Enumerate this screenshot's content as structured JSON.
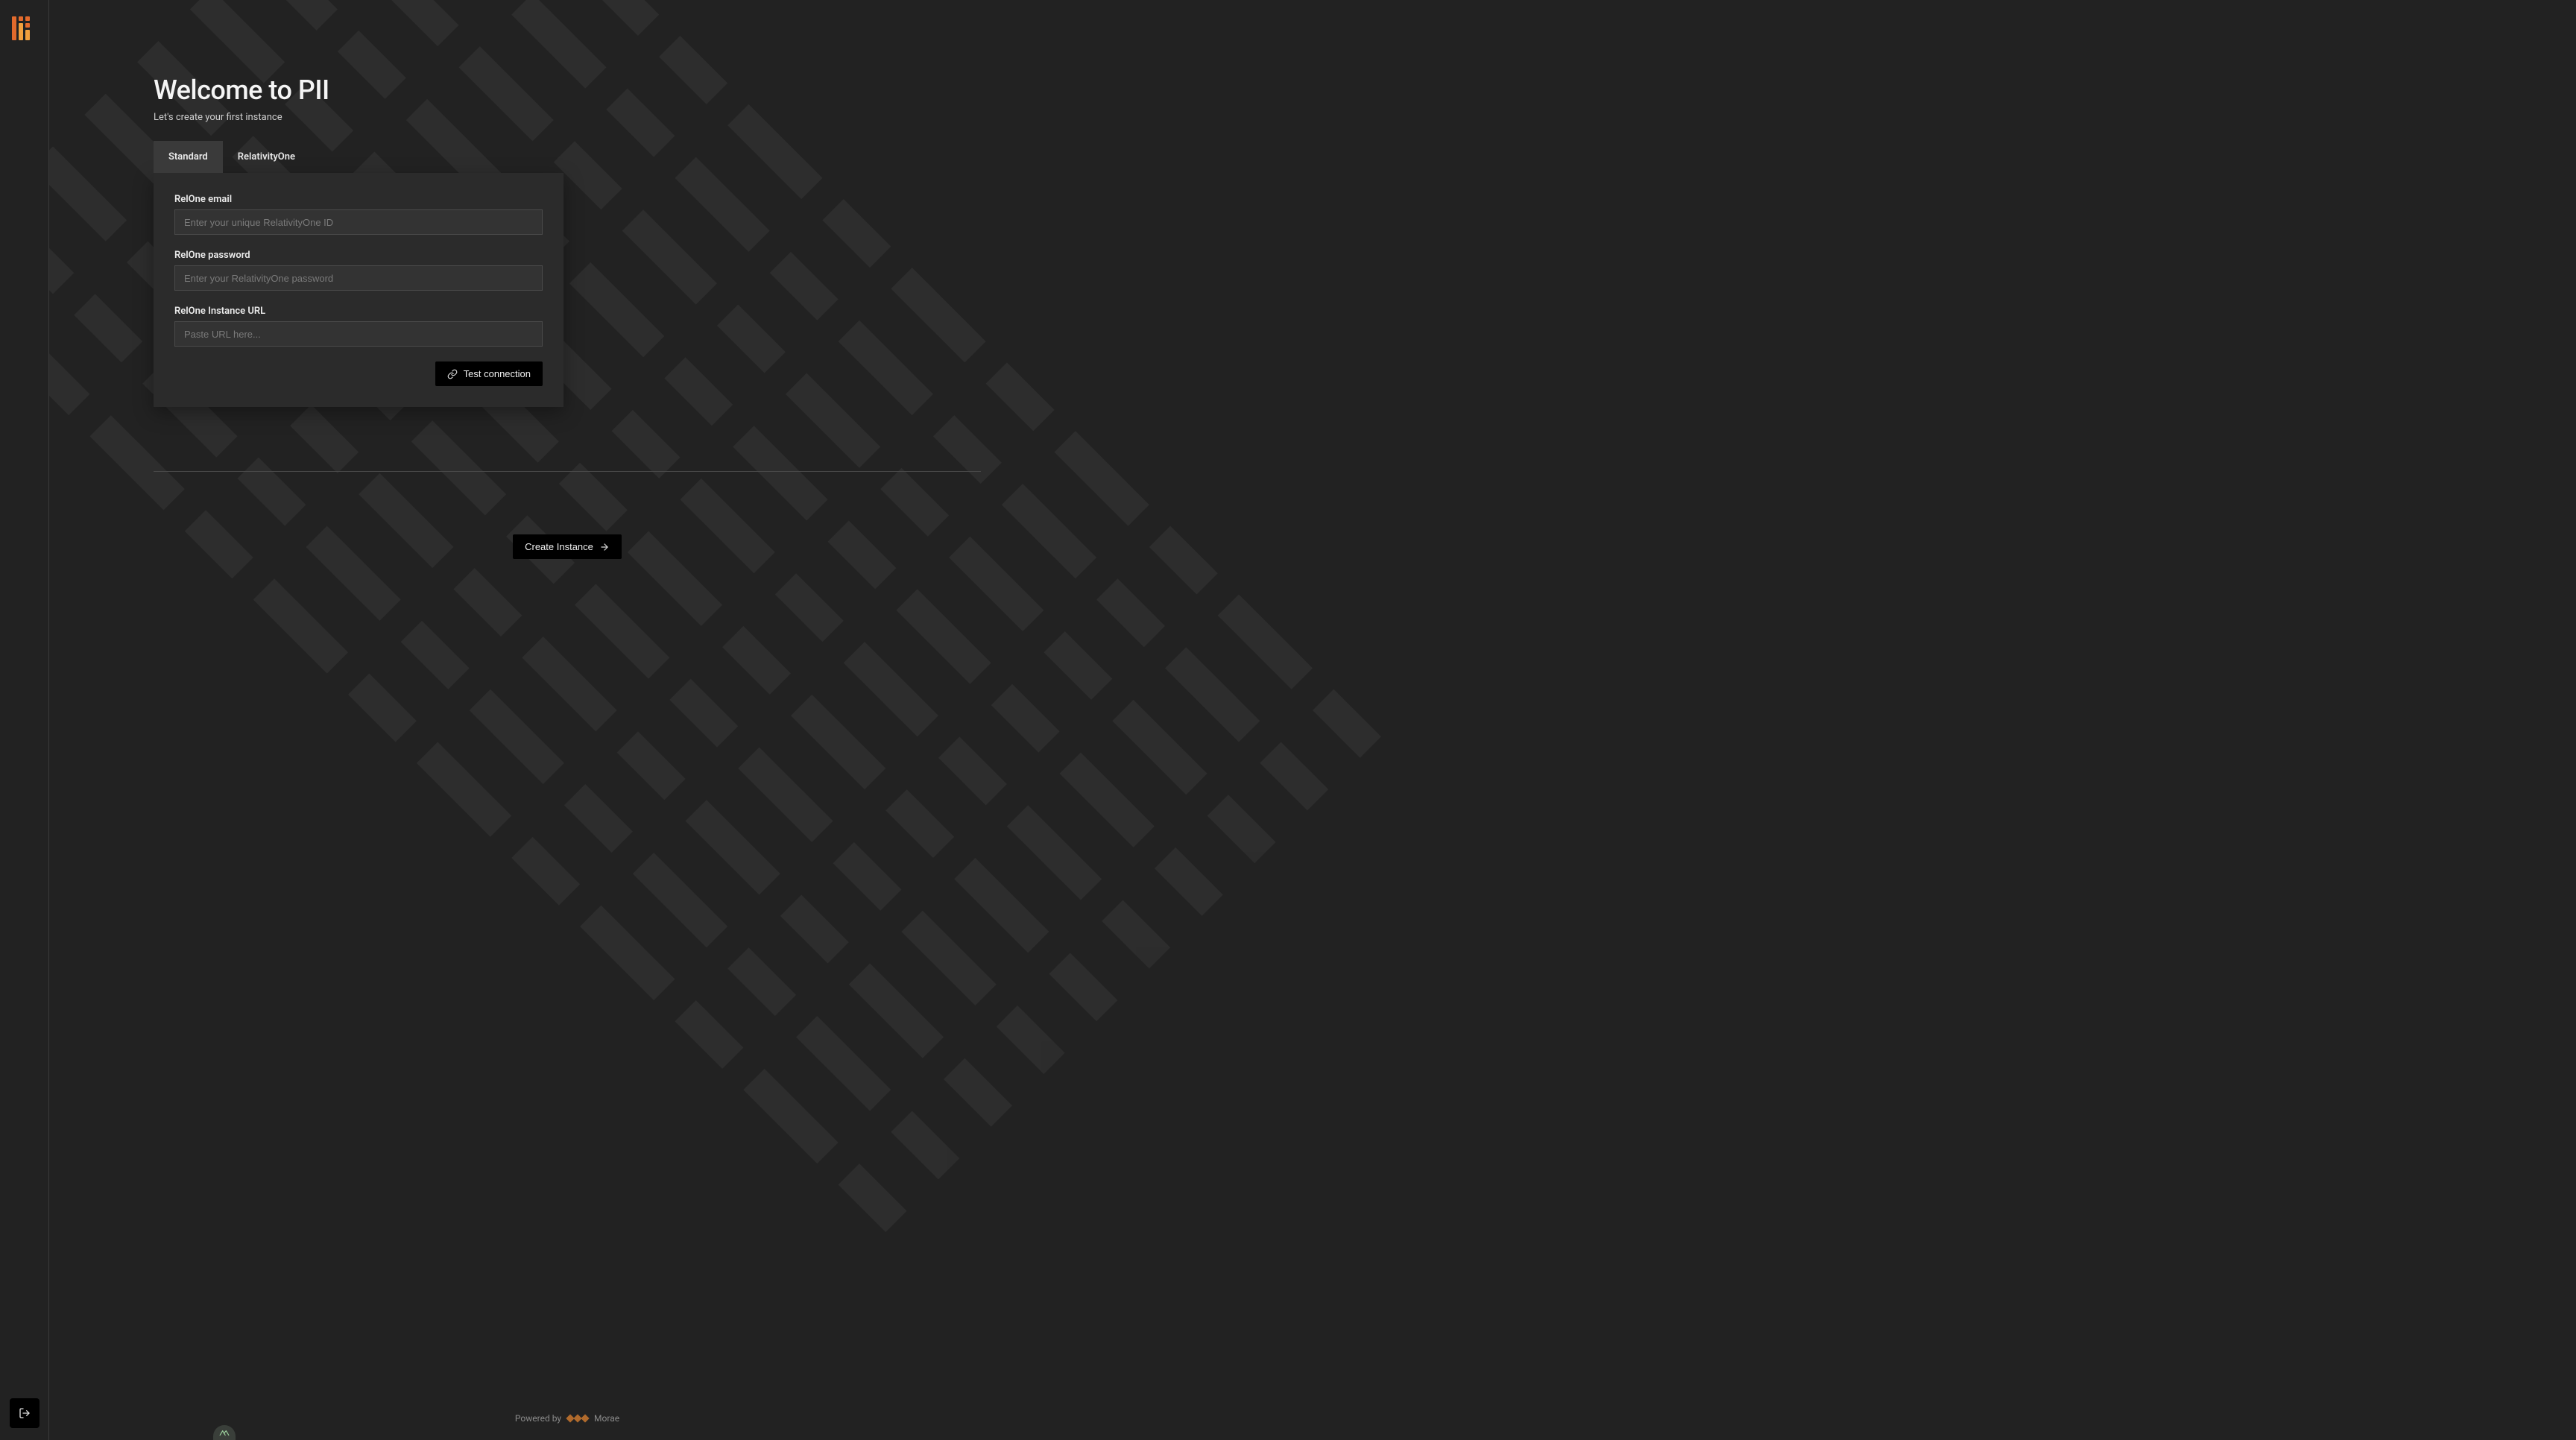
{
  "header": {
    "title": "Welcome to PII",
    "subtitle": "Let's create your first instance"
  },
  "tabs": {
    "standard": "Standard",
    "relativity": "RelativityOne"
  },
  "form": {
    "email_label": "RelOne email",
    "email_placeholder": "Enter your unique RelativityOne ID",
    "password_label": "RelOne password",
    "password_placeholder": "Enter your RelativityOne password",
    "url_label": "RelOne Instance URL",
    "url_placeholder": "Paste URL here...",
    "test_connection": "Test connection"
  },
  "actions": {
    "create_instance": "Create Instance"
  },
  "footer": {
    "powered_by": "Powered by",
    "brand": "Morae"
  }
}
